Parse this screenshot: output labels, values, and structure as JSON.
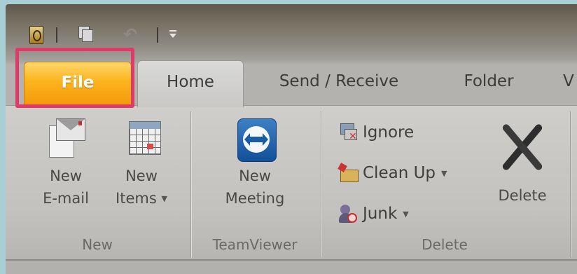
{
  "tabs": {
    "file": "File",
    "home": "Home",
    "send_receive": "Send / Receive",
    "folder": "Folder",
    "view_partial": "V"
  },
  "groups": {
    "new": {
      "label": "New",
      "new_email": [
        "New",
        "E-mail"
      ],
      "new_items": [
        "New",
        "Items"
      ]
    },
    "teamviewer": {
      "label": "TeamViewer",
      "new_meeting": [
        "New",
        "Meeting"
      ]
    },
    "delete": {
      "label": "Delete",
      "ignore": "Ignore",
      "clean_up": "Clean Up",
      "junk": "Junk",
      "delete": "Delete"
    }
  },
  "icons": {
    "app": "outlook-icon",
    "save": "save-icon",
    "undo": "undo-icon",
    "customize": "customize-qat-icon"
  },
  "colors": {
    "file_tab": "#f7a414",
    "highlight": "#e03a6a"
  }
}
